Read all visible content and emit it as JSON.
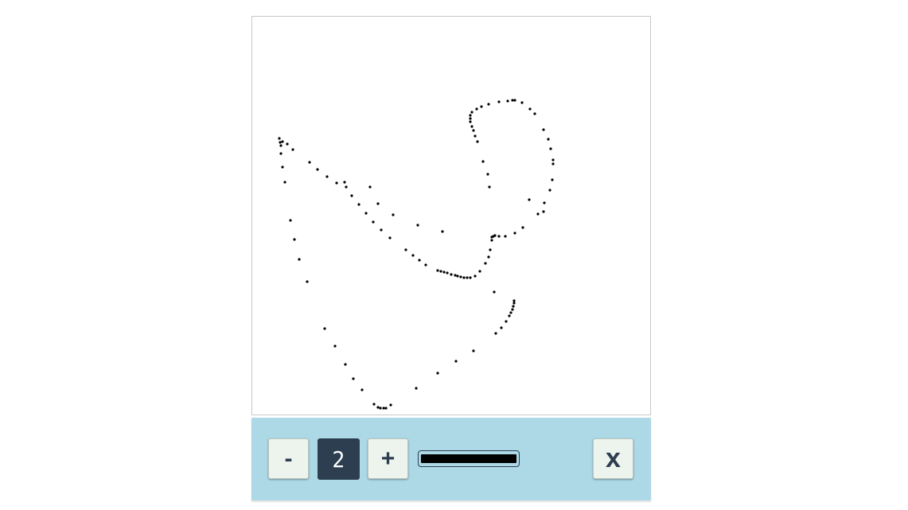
{
  "canvas": {
    "dot_color": "#000000",
    "background": "#ffffff"
  },
  "toolbar": {
    "background": "#add8e6",
    "decrease_label": "-",
    "stroke_width_value": "2",
    "increase_label": "+",
    "close_label": "x"
  }
}
